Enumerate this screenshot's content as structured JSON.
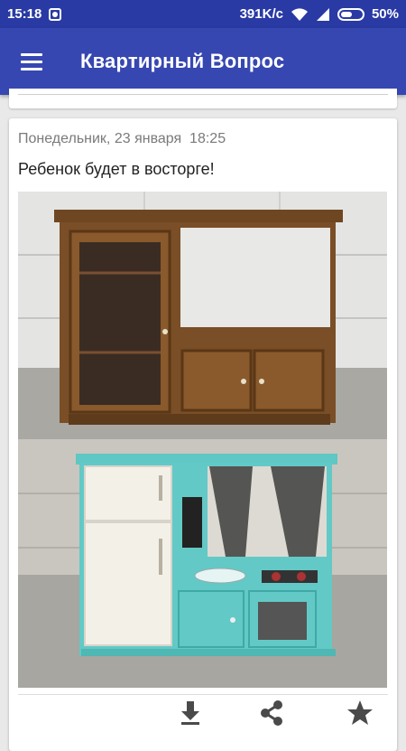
{
  "status_bar": {
    "time": "15:18",
    "network_speed": "391K/c",
    "battery": "50%"
  },
  "app_bar": {
    "title": "Квартирный Вопрос"
  },
  "post": {
    "date": "Понедельник, 23 января  18:25",
    "title": "Ребенок будет в восторге!",
    "actions": [
      "download-icon",
      "share-icon",
      "star-icon"
    ]
  },
  "colors": {
    "status_bar": "#2a3aa4",
    "app_bar": "#3747b1",
    "background": "#e9e9e9"
  }
}
